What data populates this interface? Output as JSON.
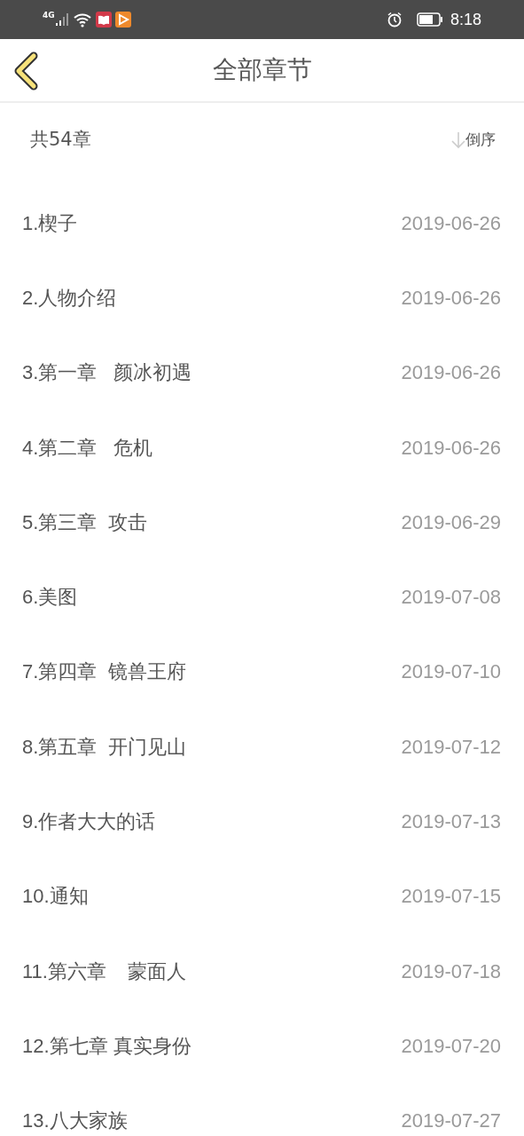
{
  "status_bar": {
    "network": "4G",
    "time": "8:18"
  },
  "header": {
    "title": "全部章节"
  },
  "summary": {
    "count": "共54章",
    "sort": "倒序"
  },
  "chapters": [
    {
      "title": "1.楔子",
      "date": "2019-06-26"
    },
    {
      "title": "2.人物介绍",
      "date": "2019-06-26"
    },
    {
      "title": "3.第一章   颜冰初遇",
      "date": "2019-06-26"
    },
    {
      "title": "4.第二章   危机",
      "date": "2019-06-26"
    },
    {
      "title": "5.第三章  攻击",
      "date": "2019-06-29"
    },
    {
      "title": "6.美图",
      "date": "2019-07-08"
    },
    {
      "title": "7.第四章  镜兽王府",
      "date": "2019-07-10"
    },
    {
      "title": "8.第五章  开门见山",
      "date": "2019-07-12"
    },
    {
      "title": "9.作者大大的话",
      "date": "2019-07-13"
    },
    {
      "title": "10.通知",
      "date": "2019-07-15"
    },
    {
      "title": "11.第六章    蒙面人",
      "date": "2019-07-18"
    },
    {
      "title": "12.第七章 真实身份",
      "date": "2019-07-20"
    },
    {
      "title": "13.八大家族",
      "date": "2019-07-27"
    }
  ]
}
